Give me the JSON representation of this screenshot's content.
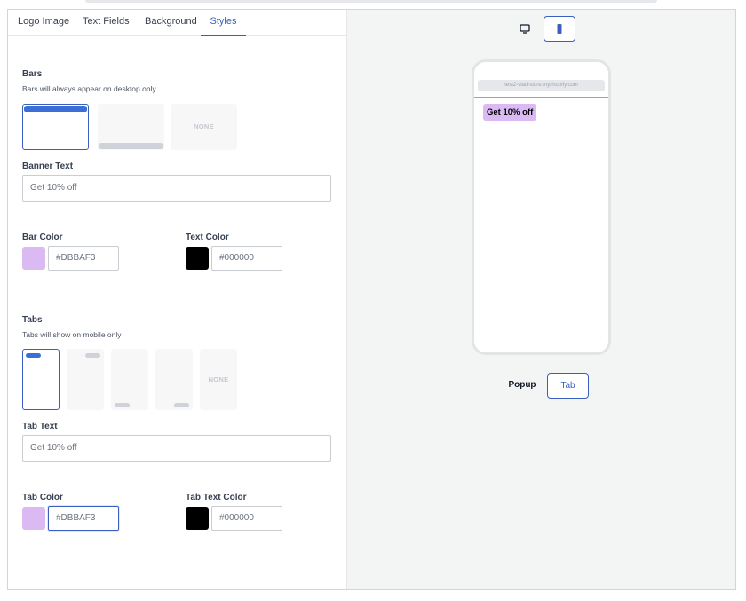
{
  "tabs": [
    {
      "label": "Logo Image"
    },
    {
      "label": "Text Fields"
    },
    {
      "label": "Background"
    },
    {
      "label": "Styles"
    }
  ],
  "active_tab": "Styles",
  "bars": {
    "title": "Bars",
    "subtitle": "Bars will always appear on desktop only",
    "options": [
      "top",
      "bottom",
      "none"
    ],
    "selected": "top",
    "none_label": "NONE"
  },
  "banner_text": {
    "label": "Banner Text",
    "value": "Get 10% off"
  },
  "bar_color": {
    "label": "Bar Color",
    "value": "#DBBAF3"
  },
  "text_color": {
    "label": "Text Color",
    "value": "#000000"
  },
  "tabs_section": {
    "title": "Tabs",
    "subtitle": "Tabs will show on mobile only",
    "options": [
      "top-left",
      "top-right",
      "bottom-left",
      "bottom-right",
      "none"
    ],
    "selected": "top-left",
    "none_label": "NONE"
  },
  "tab_text": {
    "label": "Tab Text",
    "value": "Get 10% off"
  },
  "tab_color": {
    "label": "Tab Color",
    "value": "#DBBAF3"
  },
  "tab_text_color": {
    "label": "Tab Text Color",
    "value": "#000000"
  },
  "preview": {
    "device_options": [
      "desktop-icon",
      "mobile-icon"
    ],
    "active_device": "mobile",
    "url": "test2-vlad-store.myshopify.com",
    "promo_text": "Get 10% off",
    "modes": [
      {
        "label": "Popup"
      },
      {
        "label": "Tab"
      }
    ],
    "active_mode": "Tab"
  },
  "colors": {
    "accent": "#3b5fc0",
    "bar_blue": "#3b6fd6",
    "swatch_purple": "#DBBAF3",
    "swatch_black": "#000000"
  }
}
